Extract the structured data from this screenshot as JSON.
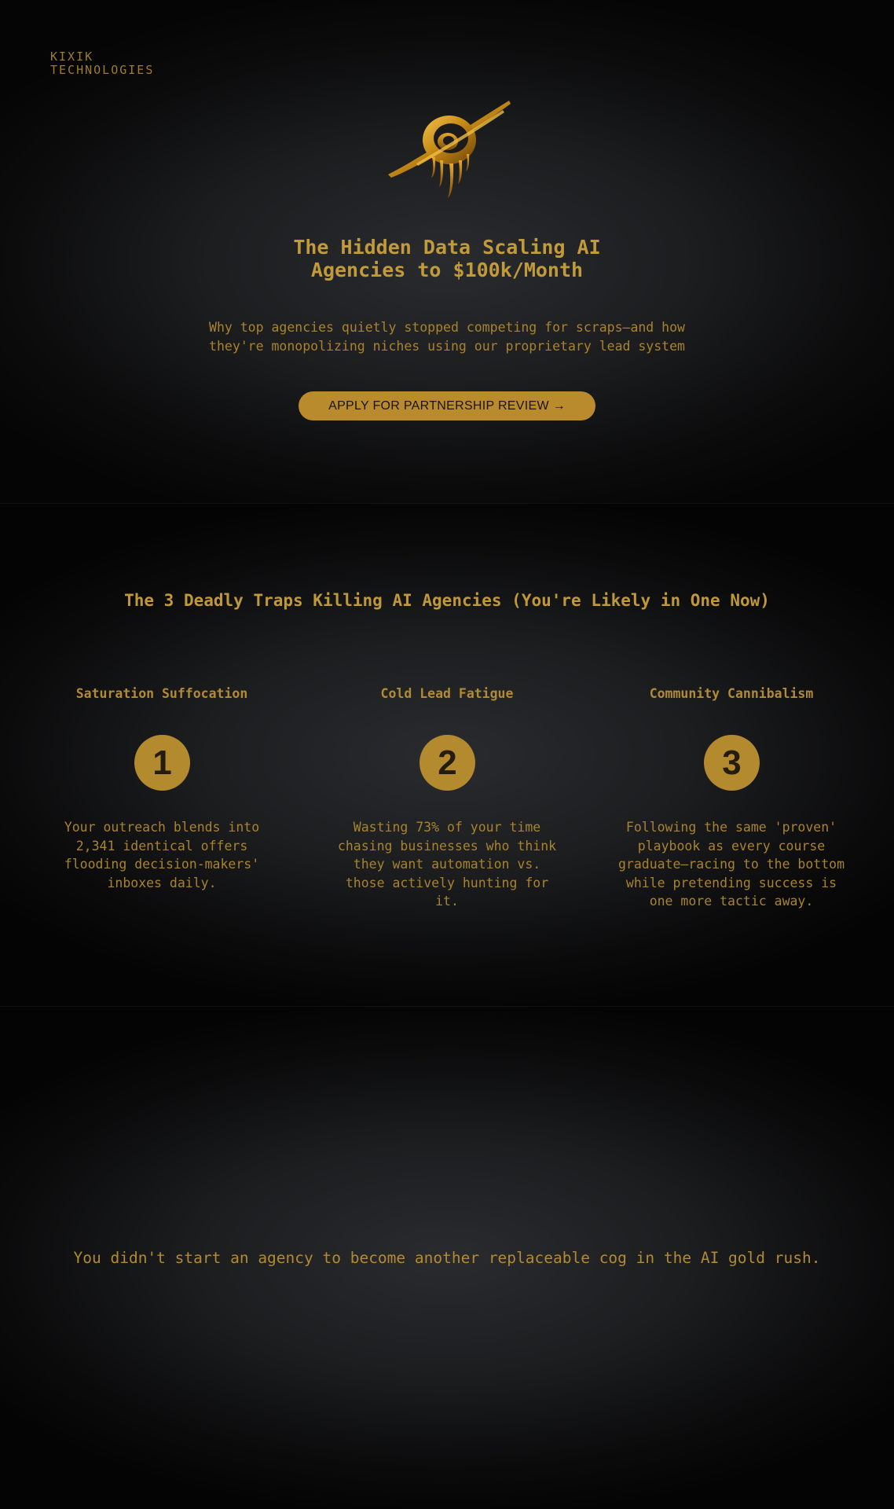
{
  "brand": {
    "line1": "KIXIK",
    "line2": "TECHNOLOGIES"
  },
  "hero": {
    "logo_icon": "golden-ringed-planet-icon",
    "title_line1": "The Hidden Data Scaling AI",
    "title_line2": "Agencies to $100k/Month",
    "subtitle_line1": "Why top agencies quietly stopped competing for scraps—and how",
    "subtitle_line2": "they're monopolizing niches using our proprietary lead system",
    "cta_label": "APPLY FOR PARTNERSHIP REVIEW →"
  },
  "traps": {
    "title": "The 3 Deadly Traps Killing AI Agencies (You're Likely in One Now)",
    "items": [
      {
        "title": "Saturation Suffocation",
        "number": "1",
        "text": "Your outreach blends into 2,341 identical offers flooding decision-makers' inboxes daily."
      },
      {
        "title": "Cold Lead Fatigue",
        "number": "2",
        "text": "Wasting 73% of your time chasing businesses who think they want automation vs. those actively hunting for it."
      },
      {
        "title": "Community Cannibalism",
        "number": "3",
        "text": "Following the same 'proven' playbook as every course graduate—racing to the bottom while pretending success is one more tactic away."
      }
    ]
  },
  "closing": {
    "text": "You didn't start an agency to become another replaceable cog in the AI gold rush."
  },
  "colors": {
    "accent": "#b48a2e",
    "background": "#000000",
    "panel": "#2a2b2e"
  }
}
